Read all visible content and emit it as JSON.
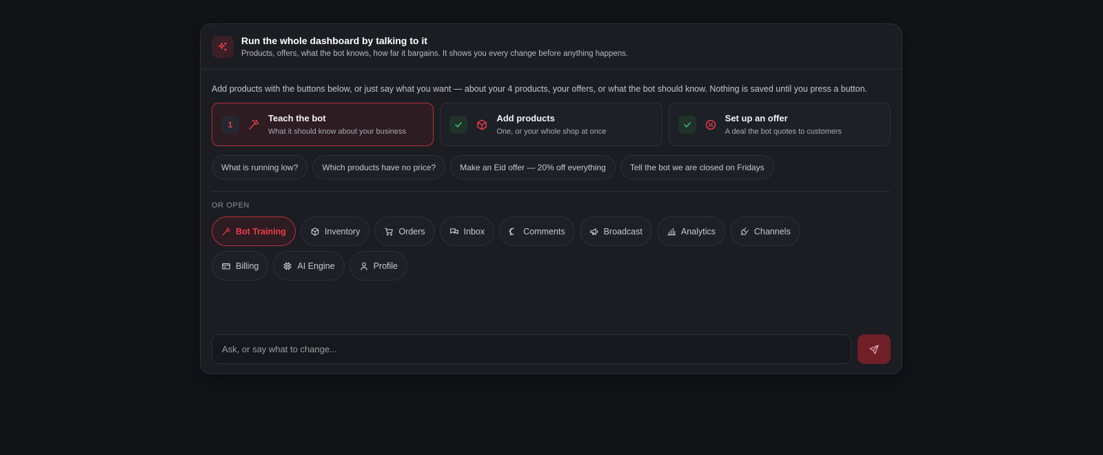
{
  "header": {
    "title": "Run the whole dashboard by talking to it",
    "subtitle": "Products, offers, what the bot knows, how far it bargains. It shows you every change before anything happens.",
    "icon": "sparkles-icon"
  },
  "intro": "Add products with the buttons below, or just say what you want — about your 4 products, your offers, or what the bot should know. Nothing is saved until you press a button.",
  "steps": [
    {
      "badge": "1",
      "state": "active",
      "icon": "wand-icon",
      "title": "Teach the bot",
      "subtitle": "What it should know about your business"
    },
    {
      "badge": "✓",
      "state": "done",
      "icon": "box-icon",
      "title": "Add products",
      "subtitle": "One, or your whole shop at once"
    },
    {
      "badge": "✓",
      "state": "done",
      "icon": "badge-percent-icon",
      "title": "Set up an offer",
      "subtitle": "A deal the bot quotes to customers"
    }
  ],
  "suggestions": [
    "What is running low?",
    "Which products have no price?",
    "Make an Eid offer — 20% off everything",
    "Tell the bot we are closed on Fridays"
  ],
  "or_open_label": "OR OPEN",
  "nav": [
    {
      "label": "Bot Training",
      "icon": "wand-icon",
      "active": true
    },
    {
      "label": "Inventory",
      "icon": "box-icon",
      "active": false
    },
    {
      "label": "Orders",
      "icon": "cart-icon",
      "active": false
    },
    {
      "label": "Inbox",
      "icon": "inbox-icon",
      "active": false
    },
    {
      "label": "Comments",
      "icon": "comment-icon",
      "active": false
    },
    {
      "label": "Broadcast",
      "icon": "megaphone-icon",
      "active": false
    },
    {
      "label": "Analytics",
      "icon": "bar-chart-icon",
      "active": false
    },
    {
      "label": "Channels",
      "icon": "plug-icon",
      "active": false
    },
    {
      "label": "Billing",
      "icon": "credit-card-icon",
      "active": false
    },
    {
      "label": "AI Engine",
      "icon": "cpu-icon",
      "active": false
    },
    {
      "label": "Profile",
      "icon": "user-icon",
      "active": false
    }
  ],
  "composer": {
    "value": "",
    "placeholder": "Ask, or say what to change...",
    "send_icon": "send-icon"
  },
  "colors": {
    "accent": "#ee3b4a",
    "success": "#3ec47a",
    "background": "#131418",
    "panel": "#1b1d23"
  }
}
